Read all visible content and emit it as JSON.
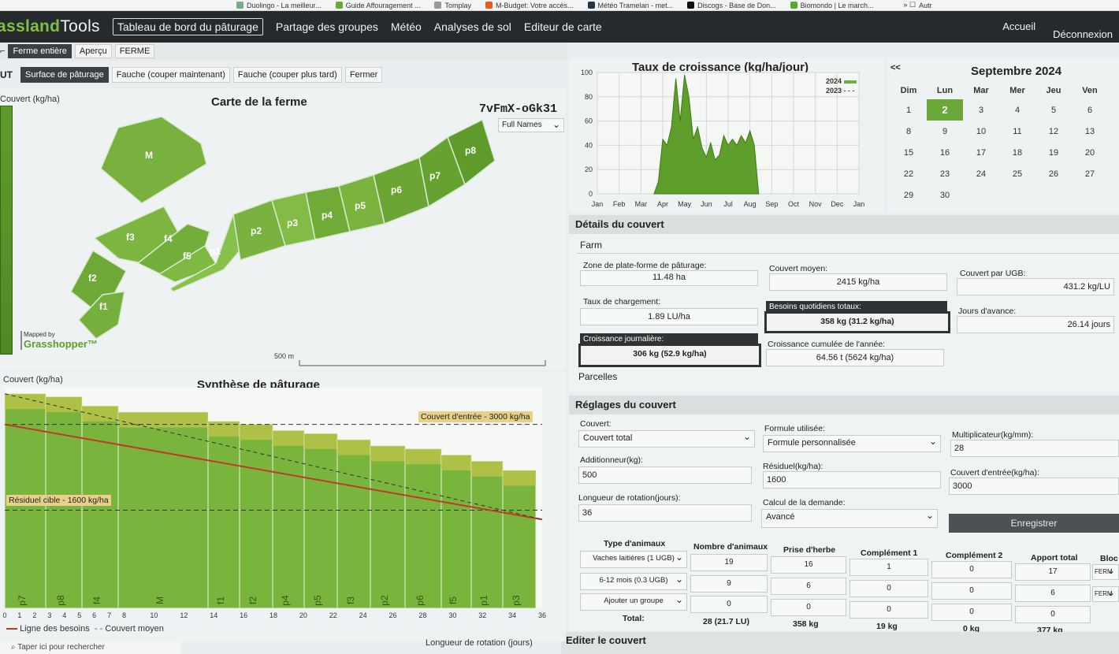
{
  "bookmarks": [
    "Duolingo - La meilleur...",
    "Guide Affouragement ...",
    "Tomplay",
    "M-Budget: Votre accès...",
    "Météo Tramelan - met...",
    "Discogs - Base de Don...",
    "Biomondo | Le march...",
    "Autr"
  ],
  "app": {
    "logo_prefix": "assland",
    "logo_suffix": "Tools"
  },
  "nav": {
    "items": [
      "Tableau de bord du pâturage",
      "Partage des groupes",
      "Météo",
      "Analyses de sol",
      "Editeur de carte"
    ],
    "right": [
      "Accueil",
      "Déconnexion"
    ]
  },
  "subnav": {
    "items": [
      "Ferme entière",
      "Aperçu",
      "FERME"
    ]
  },
  "subnav2": {
    "lead": "UT",
    "items": [
      "Surface de pâturage",
      "Fauche (couper maintenant)",
      "Fauche (couper plus tard)",
      "Fermer"
    ]
  },
  "map": {
    "title": "Carte de la ferme",
    "ylabel": "Couvert (kg/ha)",
    "code": "7vFmX-oGk31",
    "names_select": "Full Names",
    "mapped_by": "Mapped by",
    "brand": "Grasshopper™",
    "scale": "500 m",
    "paddocks": [
      "M",
      "f3",
      "f4",
      "f5",
      "p1",
      "f2",
      "f1",
      "p2",
      "p3",
      "p4",
      "p5",
      "p6",
      "p7",
      "p8"
    ]
  },
  "growth": {
    "title": "Taux de croissance (kg/ha/jour)",
    "legend": [
      "2024",
      "2023"
    ],
    "months": [
      "Jan",
      "Feb",
      "Mar",
      "Apr",
      "May",
      "Jun",
      "Jul",
      "Aug",
      "Sep",
      "Oct",
      "Nov",
      "Dec",
      "Jan"
    ],
    "yticks": [
      "100",
      "80",
      "60",
      "40",
      "20",
      "0"
    ]
  },
  "calendar": {
    "prev": "<<",
    "month": "Septembre 2024",
    "days": [
      "Dim",
      "Lun",
      "Mar",
      "Mer",
      "Jeu",
      "Ven"
    ],
    "weeks": [
      [
        "1",
        "2",
        "3",
        "4",
        "5",
        "6"
      ],
      [
        "8",
        "9",
        "10",
        "11",
        "12",
        "13"
      ],
      [
        "15",
        "16",
        "17",
        "18",
        "19",
        "20"
      ],
      [
        "22",
        "23",
        "24",
        "25",
        "26",
        "27"
      ],
      [
        "29",
        "30",
        "",
        "",
        "",
        ""
      ]
    ],
    "today": "2"
  },
  "details": {
    "header": "Détails du couvert",
    "section": "Farm",
    "zone_label": "Zone de plate-forme de pâturage:",
    "zone_value": "11.48 ha",
    "avg_label": "Couvert moyen:",
    "avg_value": "2415 kg/ha",
    "ugb_label": "Couvert par UGB:",
    "ugb_value": "431.2 kg/LU",
    "stock_label": "Taux de chargement:",
    "stock_value": "1.89 LU/ha",
    "needs_label": "Besoins quotidiens totaux:",
    "needs_value": "358 kg (31.2 kg/ha)",
    "ahead_label": "Jours d'avance:",
    "ahead_value": "26.14 jours",
    "growth_label": "Croissance journalière:",
    "growth_value": "306 kg (52.9 kg/ha)",
    "cum_label": "Croissance cumulée de l'année:",
    "cum_value": "64.56 t (5624 kg/ha)",
    "parcelles": "Parcelles"
  },
  "settings": {
    "header": "Réglages du couvert",
    "couvert_label": "Couvert:",
    "couvert_value": "Couvert total",
    "formule_label": "Formule utilisée:",
    "formule_value": "Formule personnalisée",
    "mult_label": "Multiplicateur(kg/mm):",
    "mult_value": "28",
    "add_label": "Additionneur(kg):",
    "add_value": "500",
    "res_label": "Résiduel(kg/ha):",
    "res_value": "1600",
    "entry_label": "Couvert d'entrée(kg/ha):",
    "entry_value": "3000",
    "rot_label": "Longueur de rotation(jours):",
    "rot_value": "36",
    "demand_label": "Calcul de la demande:",
    "demand_value": "Avancé",
    "save": "Enregistrer"
  },
  "animals": {
    "headers": [
      "Type d'animaux",
      "Nombre d'animaux",
      "Prise d'herbe",
      "Complément 1",
      "Complément 2",
      "Apport total",
      "Bloc"
    ],
    "rows": [
      {
        "type": "Vaches laitières (1 UGB)",
        "n": "19",
        "prise": "16",
        "c1": "1",
        "c2": "0",
        "total": "17",
        "bloc": "FERM"
      },
      {
        "type": "6-12 mois (0.3 UGB)",
        "n": "9",
        "prise": "6",
        "c1": "0",
        "c2": "0",
        "total": "6",
        "bloc": "FERM"
      },
      {
        "type": "Ajouter un groupe",
        "n": "0",
        "prise": "0",
        "c1": "0",
        "c2": "0",
        "total": "0",
        "bloc": ""
      }
    ],
    "total_label": "Total:",
    "totals": {
      "n": "28 (21.7 LU)",
      "prise": "358 kg",
      "c1": "19 kg",
      "c2": "0 kg",
      "total": "377 kg"
    }
  },
  "edit_header": "Editer le couvert",
  "synth": {
    "title": "Synthèse de pâturage",
    "ylabel": "Couvert (kg/ha)",
    "entry_label": "Couvert d'entrée - 3000 kg/ha",
    "residual_label": "Résiduel cible - 1600 kg/ha",
    "xlabel": "Longueur de rotation (jours)",
    "legend_needs": "Ligne des besoins",
    "legend_avg": "Couvert moyen",
    "xticks": [
      "0",
      "1",
      "2",
      "3",
      "4",
      "5",
      "6",
      "7",
      "8",
      "10",
      "12",
      "14",
      "16",
      "18",
      "20",
      "22",
      "24",
      "26",
      "28",
      "30",
      "32",
      "34",
      "36"
    ],
    "paddocks": [
      "p7",
      "p8",
      "f4",
      "M",
      "f1",
      "f2",
      "p4",
      "p5",
      "f3",
      "p2",
      "p6",
      "f5",
      "p1",
      "p3"
    ]
  },
  "search_placeholder": "Taper ici pour rechercher",
  "chart_data": [
    {
      "type": "area",
      "title": "Taux de croissance (kg/ha/jour)",
      "xlabel": "",
      "ylabel": "",
      "ylim": [
        0,
        100
      ],
      "categories": [
        "Jan",
        "Feb",
        "Mar",
        "Apr",
        "May",
        "Jun",
        "Jul",
        "Aug",
        "Sep",
        "Oct",
        "Nov",
        "Dec",
        "Jan"
      ],
      "series": [
        {
          "name": "2024",
          "x": [
            3.6,
            3.8,
            4.0,
            4.2,
            4.4,
            4.6,
            4.8,
            5.0,
            5.2,
            5.4,
            5.6,
            5.8,
            6.0,
            6.2,
            6.4,
            6.6,
            6.8,
            7.0,
            7.2,
            7.4,
            7.6,
            7.8,
            8.0,
            8.2,
            8.4
          ],
          "y": [
            0,
            10,
            45,
            40,
            55,
            95,
            60,
            98,
            80,
            45,
            55,
            38,
            30,
            42,
            28,
            32,
            48,
            40,
            45,
            40,
            48,
            42,
            52,
            40,
            0
          ]
        }
      ]
    },
    {
      "type": "bar",
      "title": "Synthèse de pâturage",
      "xlabel": "Longueur de rotation (jours)",
      "ylabel": "Couvert (kg/ha)",
      "categories": [
        "p7",
        "p8",
        "f4",
        "M",
        "f1",
        "f2",
        "p4",
        "p5",
        "f3",
        "p2",
        "p6",
        "f5",
        "p1",
        "p3"
      ],
      "values": [
        3500,
        3450,
        3300,
        3200,
        3050,
        3000,
        2900,
        2850,
        2750,
        2650,
        2600,
        2500,
        2400,
        2250
      ],
      "reference_lines": {
        "entry": 3000,
        "residual": 1600
      }
    }
  ]
}
